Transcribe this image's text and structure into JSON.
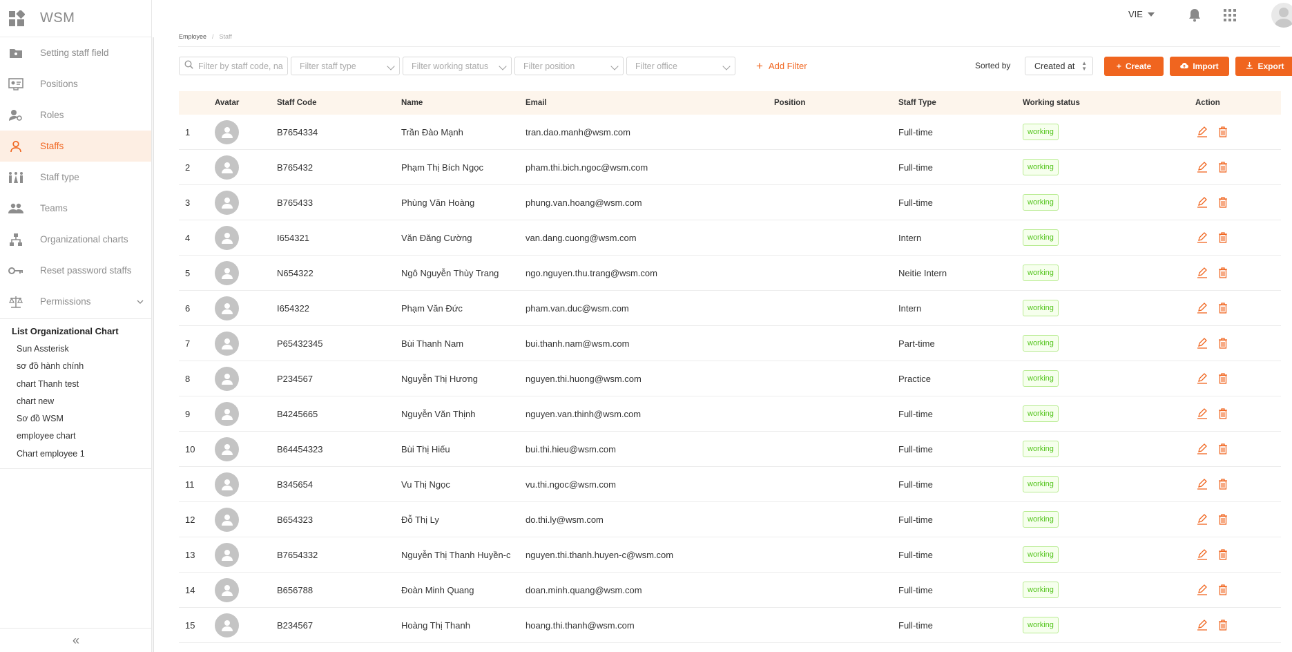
{
  "app": {
    "name": "WSM"
  },
  "header": {
    "language": "VIE"
  },
  "sidebar": {
    "items": [
      {
        "label": "Setting staff field",
        "icon": "staff-field-icon",
        "active": false
      },
      {
        "label": "Positions",
        "icon": "positions-icon",
        "active": false
      },
      {
        "label": "Roles",
        "icon": "roles-icon",
        "active": false
      },
      {
        "label": "Staffs",
        "icon": "user-icon",
        "active": true
      },
      {
        "label": "Staff type",
        "icon": "staff-type-icon",
        "active": false
      },
      {
        "label": "Teams",
        "icon": "team-icon",
        "active": false
      },
      {
        "label": "Organizational charts",
        "icon": "org-chart-icon",
        "active": false
      },
      {
        "label": "Reset password staffs",
        "icon": "key-icon",
        "active": false
      },
      {
        "label": "Permissions",
        "icon": "scale-icon",
        "active": false
      }
    ],
    "org_title": "List Organizational Chart",
    "org_charts": [
      "Sun Assterisk",
      "sơ đồ hành chính",
      "chart Thanh test",
      "chart new",
      "Sơ đồ WSM",
      "employee chart",
      "Chart employee 1"
    ],
    "collapse_symbol": "«"
  },
  "breadcrumb": {
    "parent": "Employee",
    "current": "Staff"
  },
  "toolbar": {
    "search_placeholder": "Filter by staff code, na",
    "filters": [
      "Filter staff type",
      "Filter working status",
      "Filter position",
      "Filter office"
    ],
    "add_filter": "Add Filter",
    "sorted_label": "Sorted by",
    "sorted_value": "Created at",
    "create_label": "Create",
    "import_label": "Import",
    "export_label": "Export"
  },
  "table": {
    "columns": [
      "",
      "Avatar",
      "Staff Code",
      "Name",
      "Email",
      "Position",
      "Staff Type",
      "Working status",
      "Action"
    ],
    "rows": [
      {
        "idx": "1",
        "code": "B7654334",
        "name": "Trần Đào Mạnh",
        "email": "tran.dao.manh@wsm.com",
        "position": "",
        "type": "Full-time",
        "status": "working"
      },
      {
        "idx": "2",
        "code": "B765432",
        "name": "Phạm Thị Bích Ngọc",
        "email": "pham.thi.bich.ngoc@wsm.com",
        "position": "",
        "type": "Full-time",
        "status": "working"
      },
      {
        "idx": "3",
        "code": "B765433",
        "name": "Phùng Văn Hoàng",
        "email": "phung.van.hoang@wsm.com",
        "position": "",
        "type": "Full-time",
        "status": "working"
      },
      {
        "idx": "4",
        "code": "I654321",
        "name": "Văn Đăng Cường",
        "email": "van.dang.cuong@wsm.com",
        "position": "",
        "type": "Intern",
        "status": "working"
      },
      {
        "idx": "5",
        "code": "N654322",
        "name": "Ngô Nguyễn Thùy Trang",
        "email": "ngo.nguyen.thu.trang@wsm.com",
        "position": "",
        "type": "Neitie Intern",
        "status": "working"
      },
      {
        "idx": "6",
        "code": "I654322",
        "name": "Phạm Văn Đức",
        "email": "pham.van.duc@wsm.com",
        "position": "",
        "type": "Intern",
        "status": "working"
      },
      {
        "idx": "7",
        "code": "P65432345",
        "name": "Bùi Thanh Nam",
        "email": "bui.thanh.nam@wsm.com",
        "position": "",
        "type": "Part-time",
        "status": "working"
      },
      {
        "idx": "8",
        "code": "P234567",
        "name": "Nguyễn Thị Hương",
        "email": "nguyen.thi.huong@wsm.com",
        "position": "",
        "type": "Practice",
        "status": "working"
      },
      {
        "idx": "9",
        "code": "B4245665",
        "name": "Nguyễn Văn Thịnh",
        "email": "nguyen.van.thinh@wsm.com",
        "position": "",
        "type": "Full-time",
        "status": "working"
      },
      {
        "idx": "10",
        "code": "B64454323",
        "name": "Bùi Thị Hiếu",
        "email": "bui.thi.hieu@wsm.com",
        "position": "",
        "type": "Full-time",
        "status": "working"
      },
      {
        "idx": "11",
        "code": "B345654",
        "name": "Vu Thị Ngọc",
        "email": "vu.thi.ngoc@wsm.com",
        "position": "",
        "type": "Full-time",
        "status": "working"
      },
      {
        "idx": "12",
        "code": "B654323",
        "name": "Đỗ Thị Ly",
        "email": "do.thi.ly@wsm.com",
        "position": "",
        "type": "Full-time",
        "status": "working"
      },
      {
        "idx": "13",
        "code": "B7654332",
        "name": "Nguyễn Thị Thanh Huyền-c",
        "email": "nguyen.thi.thanh.huyen-c@wsm.com",
        "position": "",
        "type": "Full-time",
        "status": "working"
      },
      {
        "idx": "14",
        "code": "B656788",
        "name": "Đoàn Minh Quang",
        "email": "doan.minh.quang@wsm.com",
        "position": "",
        "type": "Full-time",
        "status": "working"
      },
      {
        "idx": "15",
        "code": "B234567",
        "name": "Hoàng Thị Thanh",
        "email": "hoang.thi.thanh@wsm.com",
        "position": "",
        "type": "Full-time",
        "status": "working"
      }
    ]
  },
  "colors": {
    "accent": "#f0651f",
    "accent_light": "#fdeee3",
    "header_row": "#fdf5ec",
    "status_green": "#52c41a"
  }
}
